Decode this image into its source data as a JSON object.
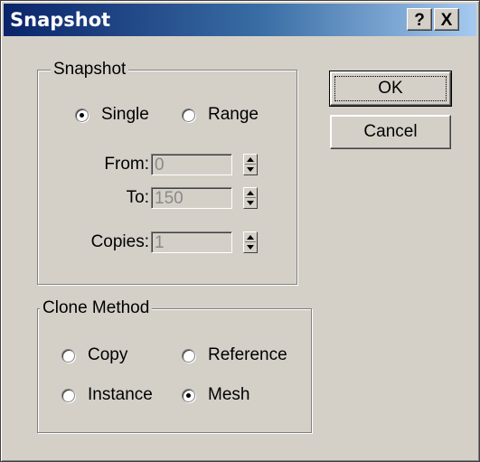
{
  "window": {
    "title": "Snapshot",
    "help_label": "?",
    "close_label": "X"
  },
  "snapshot_group": {
    "legend": "Snapshot",
    "single_label": "Single",
    "range_label": "Range",
    "selected": "Single",
    "from_label": "From:",
    "from_value": "0",
    "to_label": "To:",
    "to_value": "150",
    "copies_label": "Copies:",
    "copies_value": "1"
  },
  "clone_group": {
    "legend": "Clone Method",
    "copy_label": "Copy",
    "reference_label": "Reference",
    "instance_label": "Instance",
    "mesh_label": "Mesh",
    "selected": "Mesh"
  },
  "buttons": {
    "ok_label": "OK",
    "cancel_label": "Cancel"
  }
}
